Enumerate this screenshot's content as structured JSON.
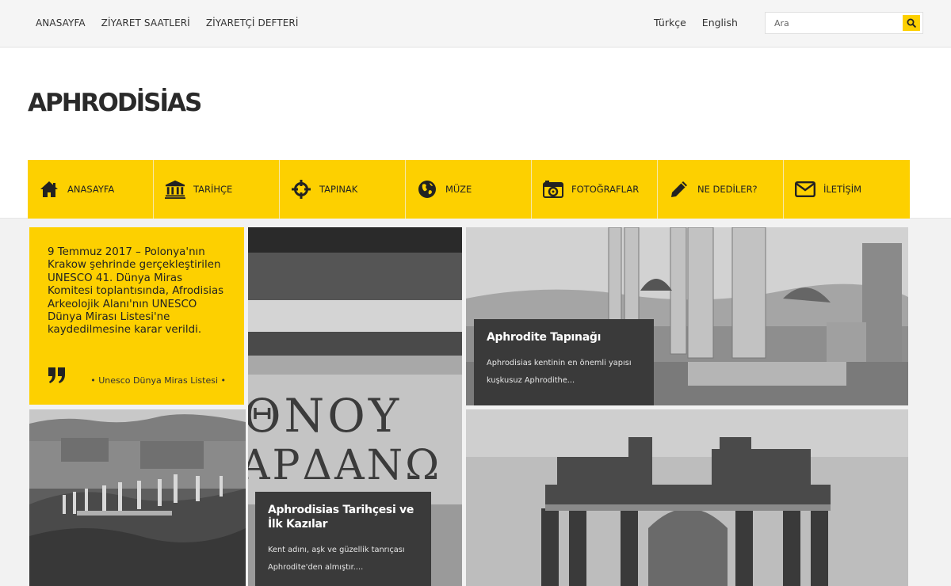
{
  "topbar": {
    "nav": [
      "ANASAYFA",
      "ZİYARET SAATLERİ",
      "ZİYARETÇİ DEFTERİ"
    ],
    "languages": [
      "Türkçe",
      "English"
    ],
    "search": {
      "placeholder": "Ara",
      "icon": "search-icon"
    }
  },
  "header": {
    "logo": "APHRODİSİAS"
  },
  "main_menu": [
    {
      "label": "ANASAYFA",
      "icon": "home-icon"
    },
    {
      "label": "TARİHÇE",
      "icon": "institution-icon"
    },
    {
      "label": "TAPINAK",
      "icon": "crosshairs-icon"
    },
    {
      "label": "MÜZE",
      "icon": "globe-icon"
    },
    {
      "label": "FOTOĞRAFLAR",
      "icon": "camera-icon"
    },
    {
      "label": "NE DEDİLER?",
      "icon": "pencil-icon"
    },
    {
      "label": "İLETİŞİM",
      "icon": "envelope-icon"
    }
  ],
  "quote": {
    "text": "9 Temmuz 2017 – Polonya'nın Krakow şehrinde gerçekleştirilen UNESCO 41. Dünya Miras Komitesi toplantısında, Afrodisias Arkeolojik Alanı'nın UNESCO Dünya Mirası Listesi'ne kaydedilmesine karar verildi.",
    "source": "• Unesco Dünya Miras Listesi •",
    "icon": "quote-icon"
  },
  "cards": [
    {
      "title": "Aphrodite Tapınağı",
      "excerpt": "Aphrodisias kentinin en önemli yapısı kuşkusuz Aphrodithe..."
    },
    {
      "title": "Aphrodisias Tarihçesi ve İlk Kazılar",
      "excerpt": "Kent adını, aşk ve güzellik tanrıçası Aphrodite'den almıştır...."
    }
  ],
  "colors": {
    "accent": "#fdd000",
    "card_bg": "#3a3a3a",
    "topbar_bg": "#f5f5f5"
  },
  "stone_inscription": [
    "ΘΝΟΥ",
    "ΑΡΔΑΝΩ"
  ]
}
